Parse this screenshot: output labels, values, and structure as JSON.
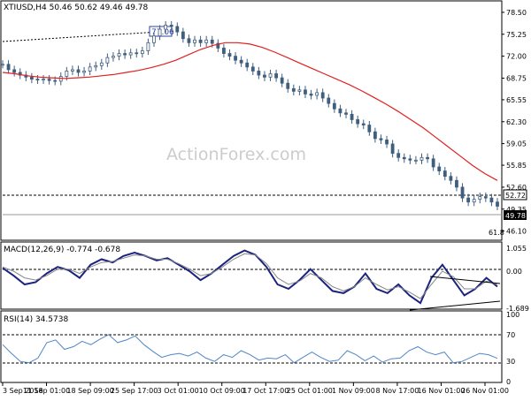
{
  "chart_data": [
    {
      "type": "candlestick",
      "panel": "price",
      "header": "XTIUSD,H4  50.46 50.62 49.46 49.78",
      "watermark": "ActionForex.com",
      "y_ticks": [
        "78.50",
        "75.25",
        "72.00",
        "68.75",
        "65.55",
        "62.30",
        "59.05",
        "55.85",
        "52.60",
        "49.35",
        "46.10"
      ],
      "ylim": [
        45.0,
        79.8
      ],
      "annotations": [
        {
          "label": "77.06",
          "value": 77.06
        },
        {
          "label": "52.72",
          "value": 52.72
        },
        {
          "label": "49.78",
          "value": 49.78
        },
        {
          "label": "61.8",
          "value": null
        }
      ],
      "series": [
        {
          "name": "price",
          "values": [
            70.8,
            70.0,
            69.6,
            69.2,
            68.9,
            68.6,
            68.5,
            68.6,
            68.4,
            68.3,
            69.0,
            69.8,
            70.0,
            69.6,
            69.8,
            70.4,
            70.6,
            71.0,
            71.8,
            72.0,
            72.4,
            72.2,
            72.5,
            72.4,
            72.8,
            74.0,
            75.0,
            76.0,
            76.6,
            76.4,
            75.6,
            74.6,
            74.0,
            74.4,
            74.0,
            74.4,
            73.9,
            73.2,
            72.4,
            72.0,
            71.4,
            71.0,
            70.4,
            69.8,
            69.2,
            68.9,
            69.4,
            68.8,
            68.0,
            67.2,
            66.8,
            67.0,
            66.4,
            66.2,
            66.6,
            65.8,
            65.0,
            64.2,
            63.6,
            63.4,
            62.6,
            62.0,
            61.8,
            60.8,
            59.8,
            59.6,
            59.0,
            57.6,
            57.0,
            56.8,
            56.6,
            56.6,
            57.0,
            56.8,
            55.6,
            55.0,
            54.2,
            53.6,
            52.6,
            51.0,
            50.4,
            50.8,
            51.2,
            51.0,
            50.4,
            49.78
          ]
        },
        {
          "name": "moving average",
          "values": [
            69.6,
            69.4,
            69.1,
            68.9,
            68.8,
            68.7,
            68.8,
            68.9,
            69.1,
            69.3,
            69.6,
            69.9,
            70.3,
            70.8,
            71.4,
            72.2,
            73.0,
            73.6,
            74.0,
            74.0,
            73.8,
            73.3,
            72.6,
            71.8,
            71.0,
            70.2,
            69.4,
            68.6,
            67.8,
            66.9,
            65.9,
            64.9,
            63.8,
            62.6,
            61.4,
            60.0,
            58.6,
            57.2,
            55.8,
            54.6,
            53.6
          ]
        }
      ],
      "xlim": [
        0,
        85
      ]
    },
    {
      "type": "line",
      "panel": "macd",
      "header": "MACD(12,26,9) -0.774 -0.678",
      "y_ticks": [
        "1.055",
        "0.00",
        "-1.689"
      ],
      "ylim": [
        -1.689,
        1.055
      ],
      "series": [
        {
          "name": "MACD",
          "values": [
            0.15,
            -0.2,
            -0.6,
            -0.5,
            -0.1,
            0.2,
            0.05,
            -0.3,
            0.3,
            0.55,
            0.4,
            0.7,
            0.85,
            0.7,
            0.5,
            0.6,
            0.3,
            0.0,
            -0.4,
            -0.1,
            0.3,
            0.7,
            0.95,
            0.75,
            0.2,
            -0.6,
            -0.8,
            -0.4,
            0.1,
            -0.4,
            -0.9,
            -1.0,
            -0.7,
            -0.1,
            -0.8,
            -1.0,
            -0.6,
            -1.1,
            -1.45,
            -0.3,
            0.3,
            -0.4,
            -1.1,
            -0.8,
            -0.3,
            -0.7
          ]
        },
        {
          "name": "signal",
          "values": [
            0.2,
            0.0,
            -0.3,
            -0.4,
            -0.2,
            0.1,
            0.1,
            -0.1,
            0.2,
            0.4,
            0.45,
            0.6,
            0.75,
            0.7,
            0.55,
            0.55,
            0.35,
            0.1,
            -0.2,
            -0.1,
            0.2,
            0.55,
            0.8,
            0.75,
            0.35,
            -0.3,
            -0.6,
            -0.45,
            -0.1,
            -0.3,
            -0.7,
            -0.9,
            -0.7,
            -0.3,
            -0.6,
            -0.85,
            -0.7,
            -0.95,
            -1.25,
            -0.6,
            0.0,
            -0.25,
            -0.8,
            -0.8,
            -0.45,
            -0.6
          ]
        }
      ]
    },
    {
      "type": "line",
      "panel": "rsi",
      "header": "RSI(14) 34.5738",
      "y_ticks": [
        "100",
        "70",
        "30",
        "0"
      ],
      "ylim": [
        0,
        100
      ],
      "series": [
        {
          "name": "RSI(14)",
          "values": [
            55,
            42,
            30,
            28,
            35,
            58,
            62,
            48,
            52,
            60,
            55,
            63,
            70,
            58,
            62,
            68,
            55,
            45,
            36,
            40,
            42,
            38,
            44,
            35,
            30,
            40,
            36,
            46,
            40,
            32,
            35,
            34,
            40,
            28,
            36,
            44,
            36,
            30,
            32,
            46,
            40,
            31,
            38,
            29,
            34,
            35,
            46,
            52,
            44,
            40,
            44,
            28,
            30,
            36,
            42,
            40,
            34.57
          ]
        }
      ]
    },
    {
      "type": "axis",
      "panel": "time",
      "x_ticks": [
        "3 Sep 2018",
        "11 Sep 01:00",
        "18 Sep 09:00",
        "25 Sep 17:00",
        "3 Oct 01:00",
        "10 Oct 09:00",
        "17 Oct 17:00",
        "25 Oct 01:00",
        "1 Nov 09:00",
        "8 Nov 17:00",
        "16 Nov 01:00",
        "26 Nov 01:00"
      ]
    }
  ]
}
